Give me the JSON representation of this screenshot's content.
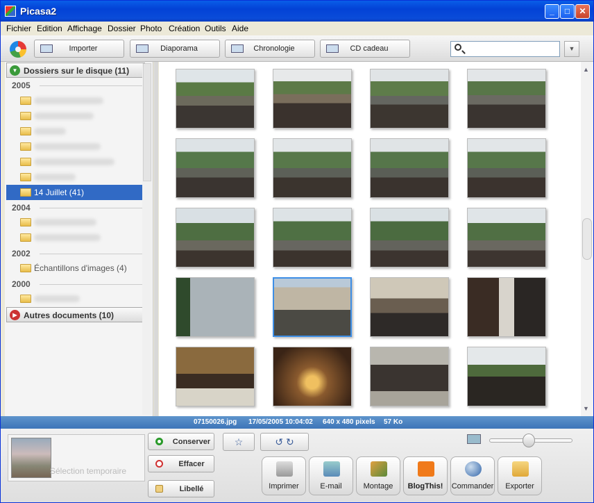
{
  "window": {
    "title": "Picasa2"
  },
  "menu": [
    "Fichier",
    "Edition",
    "Affichage",
    "Dossier",
    "Photo",
    "Création",
    "Outils",
    "Aide"
  ],
  "toolbar": {
    "import_label": "Importer",
    "slideshow_label": "Diaporama",
    "timeline_label": "Chronologie",
    "giftcd_label": "CD cadeau",
    "search_placeholder": ""
  },
  "sidebar": {
    "folders_header": "Dossiers sur le disque (11)",
    "other_header": "Autres documents (10)",
    "years": [
      "2005",
      "2004",
      "2002",
      "2000"
    ],
    "selected_folder": "14 Juillet (41)",
    "samples_folder": "Échantillons d'images (4)"
  },
  "status": {
    "filename": "07150026.jpg",
    "datetime": "17/05/2005 10:04:02",
    "dimensions": "640 x 480 pixels",
    "size": "57 Ko"
  },
  "tray": {
    "label": "Sélection temporaire"
  },
  "tray_actions": {
    "keep": "Conserver",
    "clear": "Effacer",
    "label": "Libellé"
  },
  "actions": [
    "Imprimer",
    "E-mail",
    "Montage",
    "BlogThis!",
    "Commander",
    "Exporter"
  ],
  "colors": {
    "titlebar": "#0a4cd9",
    "selection": "#316ac5",
    "infobar": "#4a82c2"
  }
}
